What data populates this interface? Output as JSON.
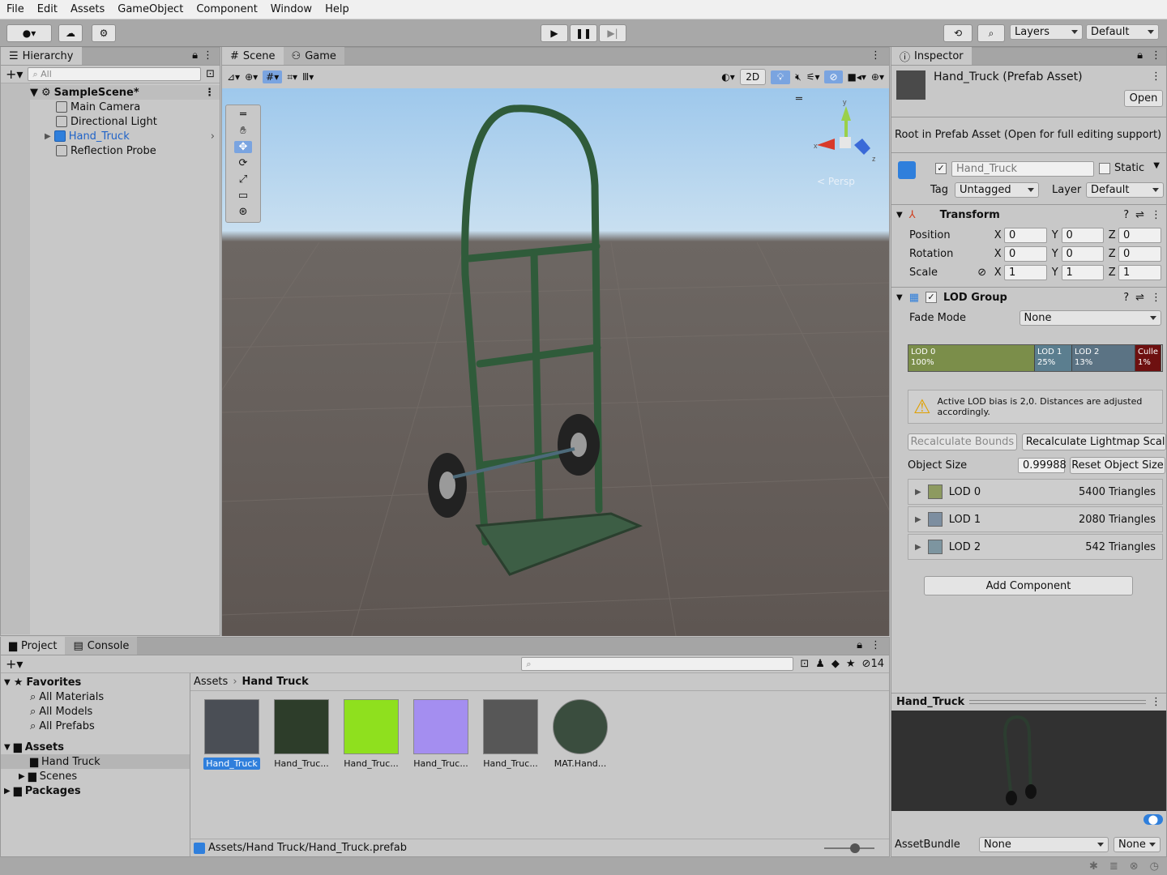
{
  "menu": [
    "File",
    "Edit",
    "Assets",
    "GameObject",
    "Component",
    "Window",
    "Help"
  ],
  "toolbar": {
    "layers": "Layers",
    "layout": "Default"
  },
  "hierarchy": {
    "tab": "Hierarchy",
    "search_placeholder": "All",
    "scene": "SampleScene*",
    "items": [
      "Main Camera",
      "Directional Light",
      "Hand_Truck",
      "Reflection Probe"
    ]
  },
  "scene": {
    "tab_scene": "Scene",
    "tab_game": "Game",
    "btn_2d": "2D",
    "persp": "< Persp",
    "gizmo_y": "y",
    "gizmo_x": "x",
    "gizmo_z": "z"
  },
  "inspector": {
    "tab": "Inspector",
    "title": "Hand_Truck (Prefab Asset)",
    "open": "Open",
    "root_note": "Root in Prefab Asset (Open for full editing support)",
    "name": "Hand_Truck",
    "static": "Static",
    "tag_label": "Tag",
    "tag": "Untagged",
    "layer_label": "Layer",
    "layer": "Default",
    "transform": {
      "title": "Transform",
      "rows": [
        {
          "label": "Position",
          "x": "0",
          "y": "0",
          "z": "0"
        },
        {
          "label": "Rotation",
          "x": "0",
          "y": "0",
          "z": "0"
        },
        {
          "label": "Scale",
          "x": "1",
          "y": "1",
          "z": "1"
        }
      ],
      "x": "X",
      "y": "Y",
      "z": "Z"
    },
    "lod": {
      "title": "LOD Group",
      "fade_label": "Fade Mode",
      "fade": "None",
      "bars": [
        {
          "name": "LOD 0",
          "pct": "100%",
          "color": "#7b8e4a"
        },
        {
          "name": "LOD 1",
          "pct": "25%",
          "color": "#5b7e8f"
        },
        {
          "name": "LOD 2",
          "pct": "13%",
          "color": "#5b7384"
        },
        {
          "name": "Culle",
          "pct": "1%",
          "color": "#6e1010"
        }
      ],
      "warning": "Active LOD bias is 2,0. Distances are adjusted accordingly.",
      "recalc_bounds": "Recalculate Bounds",
      "recalc_lightmap": "Recalculate Lightmap Scale",
      "object_size_label": "Object Size",
      "object_size": "0.99988",
      "reset_size": "Reset Object Size",
      "levels": [
        {
          "name": "LOD 0",
          "tris": "5400 Triangles",
          "color": "#8d9a60"
        },
        {
          "name": "LOD 1",
          "tris": "2080 Triangles",
          "color": "#7d8ea0"
        },
        {
          "name": "LOD 2",
          "tris": "542 Triangles",
          "color": "#7d95a0"
        }
      ]
    },
    "add_component": "Add Component",
    "preview_title": "Hand_Truck",
    "assetbundle_label": "AssetBundle",
    "assetbundle": "None",
    "variant": "None"
  },
  "project": {
    "tab_project": "Project",
    "tab_console": "Console",
    "hidden_count": "14",
    "favorites": "Favorites",
    "fav_items": [
      "All Materials",
      "All Models",
      "All Prefabs"
    ],
    "assets": "Assets",
    "asset_folders": [
      "Hand Truck",
      "Scenes"
    ],
    "packages": "Packages",
    "breadcrumb_root": "Assets",
    "breadcrumb_current": "Hand Truck",
    "thumbs": [
      "Hand_Truck",
      "Hand_Truc...",
      "Hand_Truc...",
      "Hand_Truc...",
      "Hand_Truc...",
      "MAT.Hand..."
    ],
    "path": "Assets/Hand Truck/Hand_Truck.prefab"
  }
}
